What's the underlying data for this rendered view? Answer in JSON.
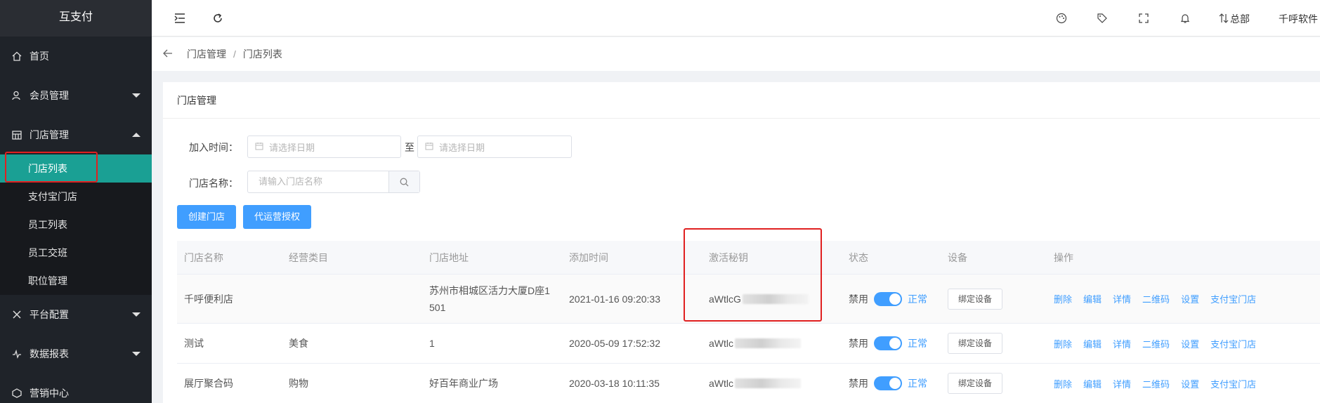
{
  "app": {
    "name": "互支付"
  },
  "sidebar": {
    "items": [
      {
        "label": "首页",
        "icon": "home-icon"
      },
      {
        "label": "会员管理",
        "icon": "user-icon"
      },
      {
        "label": "门店管理",
        "icon": "store-icon"
      },
      {
        "label": "平台配置",
        "icon": "tools-icon"
      },
      {
        "label": "数据报表",
        "icon": "pulse-icon"
      },
      {
        "label": "营销中心",
        "icon": "tag-icon"
      }
    ],
    "store_sub": [
      "门店列表",
      "支付宝门店",
      "员工列表",
      "员工交班",
      "职位管理"
    ],
    "active": "门店列表"
  },
  "topbar": {
    "branch": "总部",
    "user": "千呼软件"
  },
  "breadcrumb": [
    "门店管理",
    "门店列表"
  ],
  "card": {
    "title": "门店管理"
  },
  "filters": {
    "join_time_label": "加入时间：",
    "date_placeholder": "请选择日期",
    "to": "至",
    "name_label": "门店名称：",
    "name_placeholder": "请输入门店名称"
  },
  "buttons": {
    "create": "创建门店",
    "proxy_auth": "代运营授权"
  },
  "table": {
    "headers": [
      "门店名称",
      "经营类目",
      "门店地址",
      "添加时间",
      "激活秘钥",
      "状态",
      "设备",
      "操作"
    ],
    "rows": [
      {
        "name": "千呼便利店",
        "category": "",
        "address_l1": "苏州市相城区活力大厦D座1",
        "address_l2": "501",
        "time": "2021-01-16 09:20:33",
        "key_prefix": "aWtlcG"
      },
      {
        "name": "测试",
        "category": "美食",
        "address_l1": "1",
        "address_l2": "",
        "time": "2020-05-09 17:52:32",
        "key_prefix": "aWtlc"
      },
      {
        "name": "展厅聚合码",
        "category": "购物",
        "address_l1": "好百年商业广场",
        "address_l2": "",
        "time": "2020-03-18 10:11:35",
        "key_prefix": "aWtlc"
      }
    ],
    "status": {
      "off": "禁用",
      "on": "正常"
    },
    "bind_label": "绑定设备",
    "actions": [
      "删除",
      "编辑",
      "详情",
      "二维码",
      "设置",
      "支付宝门店"
    ]
  },
  "colors": {
    "sidebar_bg": "#1f2329",
    "active": "#1aa094",
    "primary": "#409eff",
    "highlight": "#e02020"
  }
}
